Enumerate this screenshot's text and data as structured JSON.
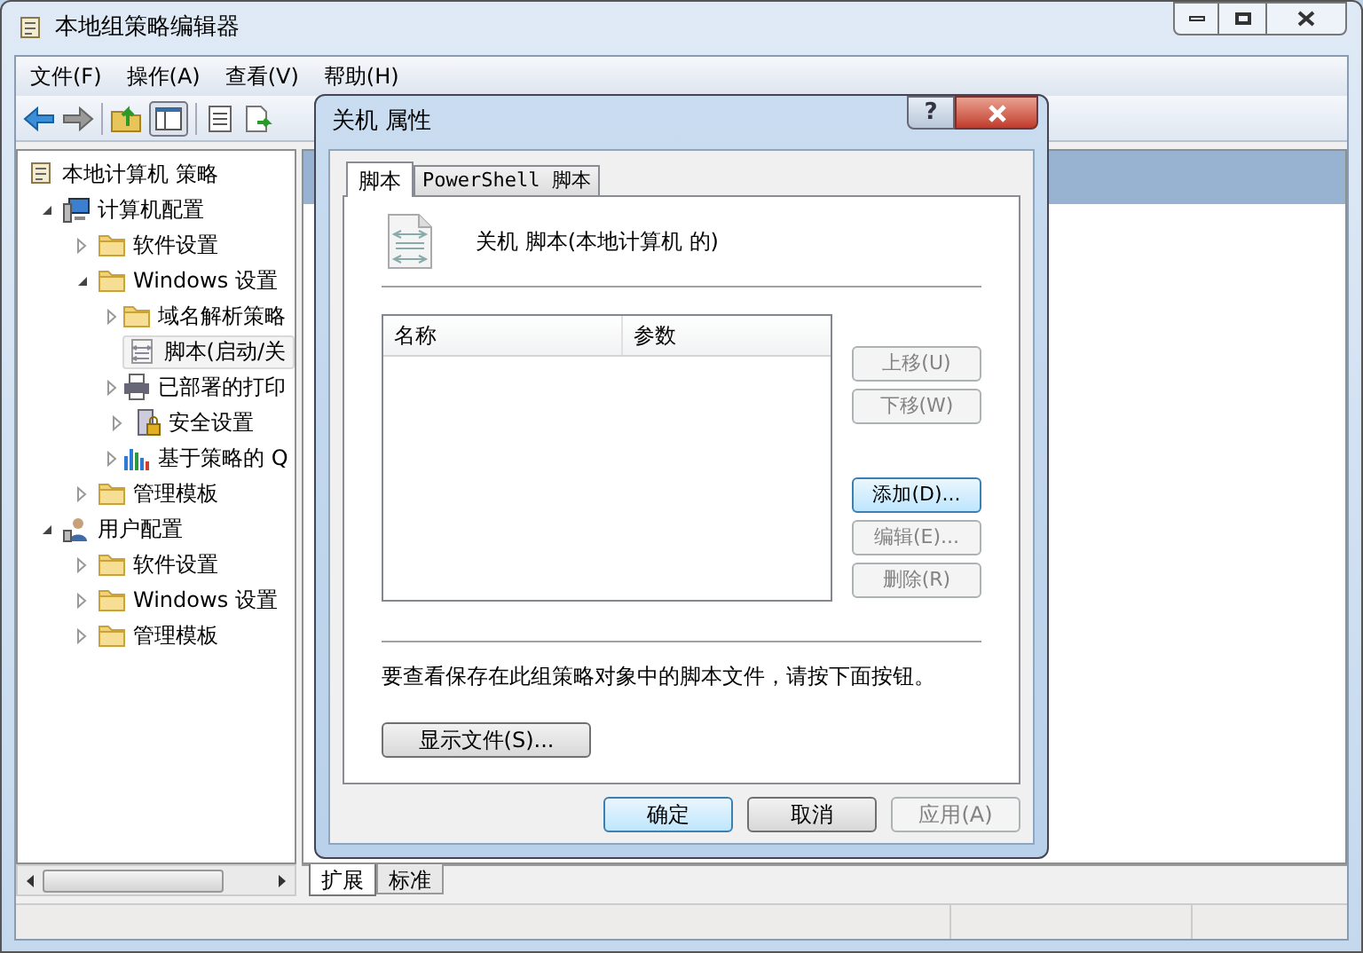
{
  "window": {
    "title": "本地组策略编辑器"
  },
  "menu": [
    "文件(F)",
    "操作(A)",
    "查看(V)",
    "帮助(H)"
  ],
  "tree": [
    {
      "label": "本地计算机 策略",
      "kind": "scroll",
      "selected": false,
      "children": [
        {
          "label": "计算机配置",
          "kind": "computer",
          "expanded": true,
          "selected": false,
          "children": [
            {
              "label": "软件设置",
              "kind": "folder",
              "expanded": false,
              "selected": false
            },
            {
              "label": "Windows 设置",
              "kind": "folder",
              "expanded": true,
              "selected": false,
              "children": [
                {
                  "label": "域名解析策略",
                  "kind": "folder",
                  "expanded": false,
                  "selected": false
                },
                {
                  "label": "脚本(启动/关",
                  "kind": "script",
                  "selected": true
                },
                {
                  "label": "已部署的打印",
                  "kind": "printer",
                  "expanded": false,
                  "selected": false
                },
                {
                  "label": "安全设置",
                  "kind": "lock",
                  "expanded": false,
                  "selected": false
                },
                {
                  "label": "基于策略的 Q",
                  "kind": "chart",
                  "expanded": false,
                  "selected": false
                }
              ]
            },
            {
              "label": "管理模板",
              "kind": "folder",
              "expanded": false,
              "selected": false
            }
          ]
        },
        {
          "label": "用户配置",
          "kind": "user",
          "expanded": true,
          "selected": false,
          "children": [
            {
              "label": "软件设置",
              "kind": "folder",
              "expanded": false,
              "selected": false
            },
            {
              "label": "Windows 设置",
              "kind": "folder",
              "expanded": false,
              "selected": false
            },
            {
              "label": "管理模板",
              "kind": "folder",
              "expanded": false,
              "selected": false
            }
          ]
        }
      ]
    }
  ],
  "view_tabs": [
    {
      "label": "扩展",
      "selected": true
    },
    {
      "label": "标准",
      "selected": false
    }
  ],
  "dialog": {
    "title": "关机 属性",
    "help": "?",
    "tabs": [
      {
        "label": "脚本",
        "selected": true
      },
      {
        "label": "PowerShell 脚本",
        "selected": false
      }
    ],
    "heading": "关机 脚本(本地计算机 的)",
    "columns": [
      "名称",
      "参数"
    ],
    "move_buttons": [
      {
        "label": "上移(U)",
        "disabled": true
      },
      {
        "label": "下移(W)",
        "disabled": true
      }
    ],
    "action_buttons": [
      {
        "label": "添加(D)...",
        "disabled": false,
        "default": true
      },
      {
        "label": "编辑(E)...",
        "disabled": true,
        "default": false
      },
      {
        "label": "删除(R)",
        "disabled": true,
        "default": false
      }
    ],
    "note": "要查看保存在此组策略对象中的脚本文件，请按下面按钮。",
    "show_files": "显示文件(S)...",
    "buttons": [
      {
        "label": "确定",
        "disabled": false,
        "default": true
      },
      {
        "label": "取消",
        "disabled": false,
        "default": false
      },
      {
        "label": "应用(A)",
        "disabled": true,
        "default": false
      }
    ]
  }
}
